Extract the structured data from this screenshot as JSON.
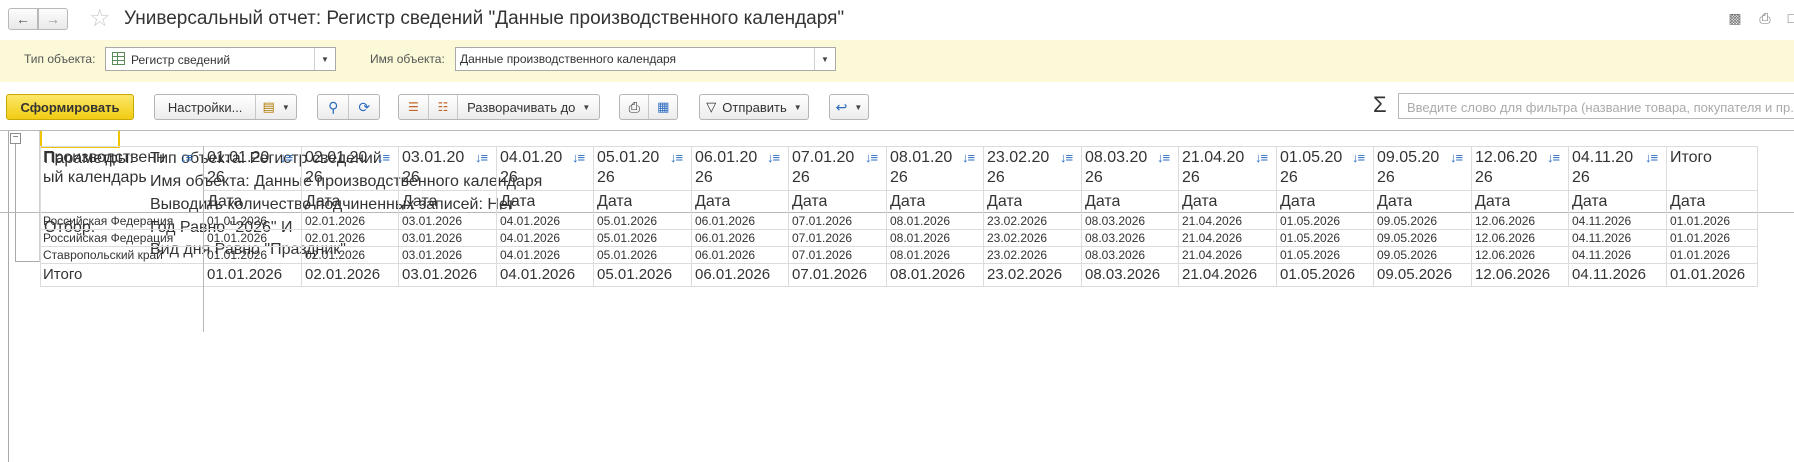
{
  "window": {
    "title": "Универсальный отчет: Регистр сведений \"Данные производственного календаря\"",
    "back_icon": "arrow-left-icon",
    "forward_icon": "arrow-right-icon",
    "favorite_icon": "star-icon"
  },
  "params": {
    "object_type_label": "Тип объекта:",
    "object_type_value": "Регистр сведений",
    "object_name_label": "Имя объекта:",
    "object_name_value": "Данные производственного календаря"
  },
  "toolbar": {
    "generate_label": "Сформировать",
    "settings_label": "Настройки...",
    "expand_label": "Разворачивать до",
    "send_label": "Отправить",
    "filter_placeholder": "Введите слово для фильтра (название товара, покупателя и пр.)"
  },
  "report_params": {
    "params_label": "Параметры:",
    "filter_label": "Отбор:",
    "lines": [
      "Тип объекта: Регистр сведений",
      "Имя объекта: Данные производственного календаря",
      "Выводить количество подчиненных записей: Нет",
      "Год Равно \"2026\" И",
      "Вид дня Равно \"Праздник\""
    ]
  },
  "table": {
    "row_header": [
      "Производственн",
      "ый календарь"
    ],
    "columns": [
      [
        "01.01.20",
        "26"
      ],
      [
        "02.01.20",
        "26"
      ],
      [
        "03.01.20",
        "26"
      ],
      [
        "04.01.20",
        "26"
      ],
      [
        "05.01.20",
        "26"
      ],
      [
        "06.01.20",
        "26"
      ],
      [
        "07.01.20",
        "26"
      ],
      [
        "08.01.20",
        "26"
      ],
      [
        "23.02.20",
        "26"
      ],
      [
        "08.03.20",
        "26"
      ],
      [
        "21.04.20",
        "26"
      ],
      [
        "01.05.20",
        "26"
      ],
      [
        "09.05.20",
        "26"
      ],
      [
        "12.06.20",
        "26"
      ],
      [
        "04.11.20",
        "26"
      ]
    ],
    "total_col_label": "Итого",
    "sub_label": "Дата",
    "rows": [
      {
        "label": "Российская Федерация",
        "values": [
          "01.01.2026",
          "02.01.2026",
          "03.01.2026",
          "04.01.2026",
          "05.01.2026",
          "06.01.2026",
          "07.01.2026",
          "08.01.2026",
          "23.02.2026",
          "08.03.2026",
          "21.04.2026",
          "01.05.2026",
          "09.05.2026",
          "12.06.2026",
          "04.11.2026",
          "01.01.2026"
        ]
      },
      {
        "label": "Российская Федерация",
        "values": [
          "01.01.2026",
          "02.01.2026",
          "03.01.2026",
          "04.01.2026",
          "05.01.2026",
          "06.01.2026",
          "07.01.2026",
          "08.01.2026",
          "23.02.2026",
          "08.03.2026",
          "21.04.2026",
          "01.05.2026",
          "09.05.2026",
          "12.06.2026",
          "04.11.2026",
          "01.01.2026"
        ]
      },
      {
        "label": "Ставропольский край",
        "values": [
          "01.01.2026",
          "02.01.2026",
          "03.01.2026",
          "04.01.2026",
          "05.01.2026",
          "06.01.2026",
          "07.01.2026",
          "08.01.2026",
          "23.02.2026",
          "08.03.2026",
          "21.04.2026",
          "01.05.2026",
          "09.05.2026",
          "12.06.2026",
          "04.11.2026",
          "01.01.2026"
        ]
      }
    ],
    "total_row": {
      "label": "Итого",
      "values": [
        "01.01.2026",
        "02.01.2026",
        "03.01.2026",
        "04.01.2026",
        "05.01.2026",
        "06.01.2026",
        "07.01.2026",
        "08.01.2026",
        "23.02.2026",
        "08.03.2026",
        "21.04.2026",
        "01.05.2026",
        "09.05.2026",
        "12.06.2026",
        "04.11.2026",
        "01.01.2026"
      ]
    }
  }
}
